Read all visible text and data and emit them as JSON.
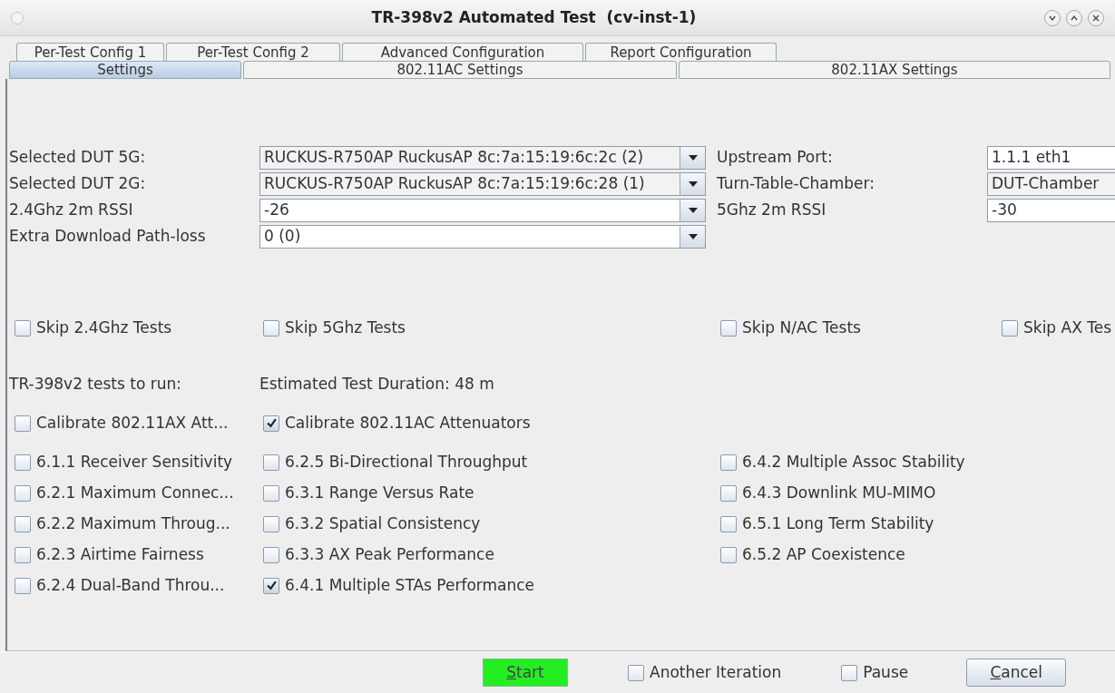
{
  "window": {
    "title": "TR-398v2 Automated Test  (cv-inst-1)"
  },
  "tabs": [
    {
      "label": "Per-Test Config 1",
      "selected": false
    },
    {
      "label": "Per-Test Config 2",
      "selected": false
    },
    {
      "label": "Advanced Configuration",
      "selected": false
    },
    {
      "label": "Report Configuration",
      "selected": false
    }
  ],
  "subtabs": [
    {
      "label": "Settings",
      "selected": true
    },
    {
      "label": "802.11AC Settings",
      "selected": false
    },
    {
      "label": "802.11AX Settings",
      "selected": false
    }
  ],
  "form_rows": [
    {
      "left": {
        "label": "Selected DUT 5G:",
        "value": "RUCKUS-R750AP RuckusAP 8c:7a:15:19:6c:2c (2)",
        "kind": "combo",
        "editable": false
      },
      "right": {
        "label": "Upstream Port:",
        "value": "1.1.1 eth1",
        "editable": true
      }
    },
    {
      "left": {
        "label": "Selected DUT 2G:",
        "value": "RUCKUS-R750AP RuckusAP 8c:7a:15:19:6c:28 (1)",
        "kind": "combo",
        "editable": false
      },
      "right": {
        "label": "Turn-Table-Chamber:",
        "value": "DUT-Chamber",
        "editable": false
      }
    },
    {
      "left": {
        "label": "2.4Ghz 2m RSSI",
        "value": "-26",
        "kind": "combo",
        "editable": true
      },
      "right": {
        "label": "5Ghz 2m RSSI",
        "value": "-30",
        "editable": true
      }
    },
    {
      "left": {
        "label": "Extra Download Path-loss",
        "value": "0 (0)",
        "kind": "combo",
        "editable": true
      }
    }
  ],
  "skip_options": [
    {
      "label": "Skip 2.4Ghz Tests",
      "checked": false
    },
    {
      "label": "Skip 5Ghz Tests",
      "checked": false
    },
    {
      "label": "Skip N/AC Tests",
      "checked": false
    },
    {
      "label": "Skip AX Tes",
      "checked": false
    }
  ],
  "tests_heading": "TR-398v2 tests to run:",
  "duration": "Estimated Test Duration: 48 m",
  "test_rows": [
    [
      {
        "label": "Calibrate 802.11AX Att...",
        "checked": false
      },
      {
        "label": "Calibrate 802.11AC Attenuators",
        "checked": true
      }
    ],
    [
      {
        "label": "6.1.1 Receiver Sensitivity",
        "checked": false
      },
      {
        "label": "6.2.5 Bi-Directional Throughput",
        "checked": false
      },
      {
        "label": "6.4.2 Multiple Assoc Stability",
        "checked": false
      }
    ],
    [
      {
        "label": "6.2.1 Maximum Connec...",
        "checked": false
      },
      {
        "label": "6.3.1 Range Versus Rate",
        "checked": false
      },
      {
        "label": "6.4.3 Downlink MU-MIMO",
        "checked": false
      }
    ],
    [
      {
        "label": "6.2.2 Maximum Throug...",
        "checked": false
      },
      {
        "label": "6.3.2 Spatial Consistency",
        "checked": false
      },
      {
        "label": "6.5.1 Long Term Stability",
        "checked": false
      }
    ],
    [
      {
        "label": "6.2.3 Airtime Fairness",
        "checked": false
      },
      {
        "label": "6.3.3 AX Peak Performance",
        "checked": false
      },
      {
        "label": "6.5.2 AP Coexistence",
        "checked": false
      }
    ],
    [
      {
        "label": "6.2.4 Dual-Band Throu...",
        "checked": false
      },
      {
        "label": "6.4.1 Multiple STAs Performance",
        "checked": true
      }
    ]
  ],
  "footer": {
    "start": "Start",
    "another_iteration": {
      "label": "Another Iteration",
      "checked": false
    },
    "pause": {
      "label": "Pause",
      "checked": false
    },
    "cancel": "Cancel"
  }
}
